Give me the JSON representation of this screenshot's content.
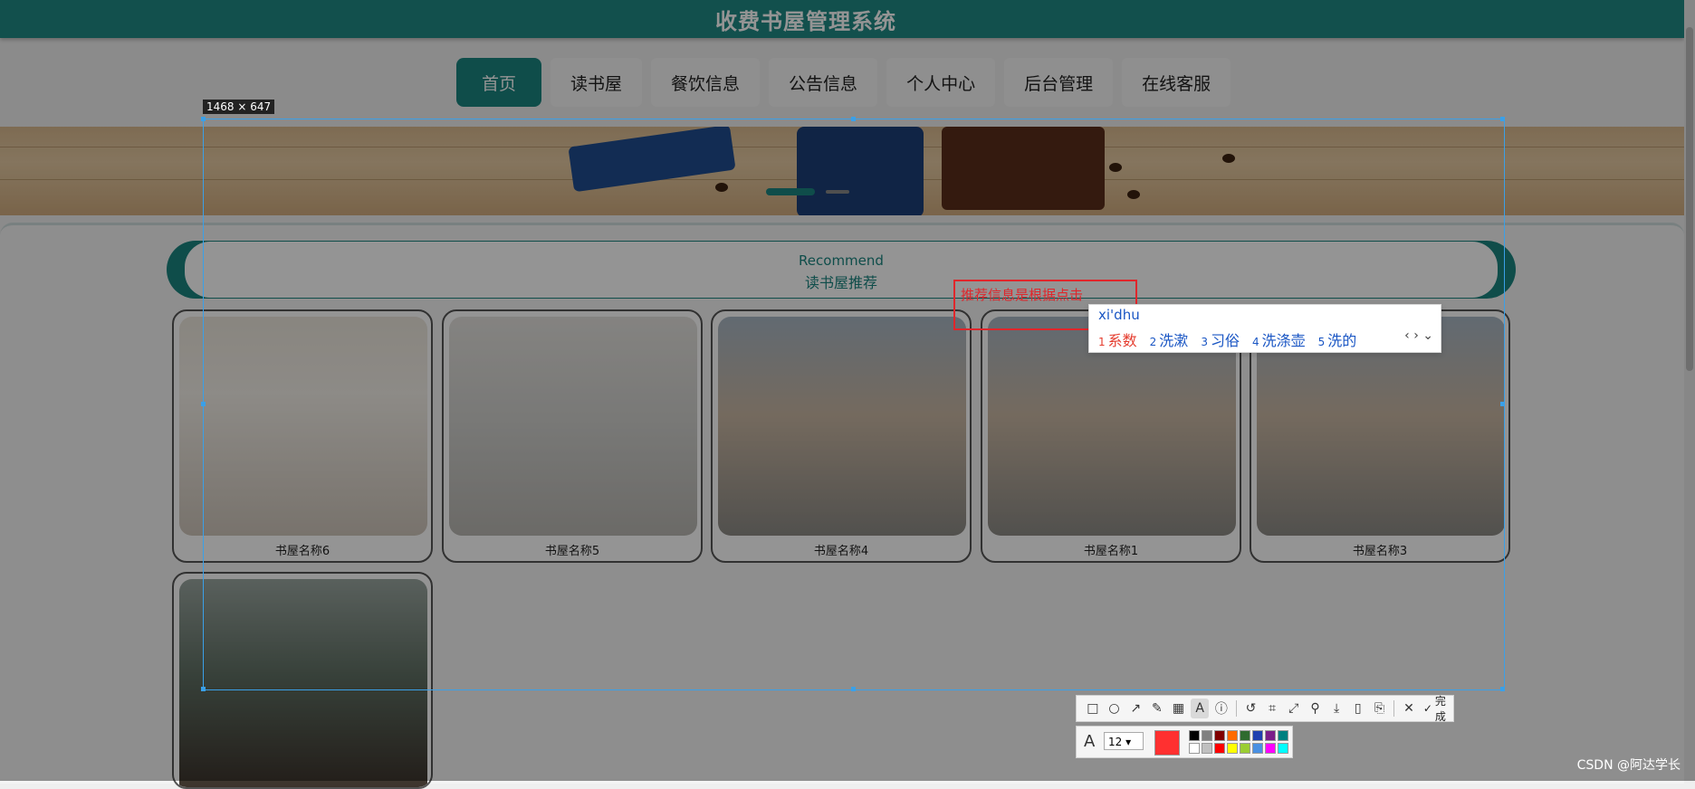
{
  "site": {
    "title": "收费书屋管理系统"
  },
  "nav": {
    "items": [
      "首页",
      "读书屋",
      "餐饮信息",
      "公告信息",
      "个人中心",
      "后台管理",
      "在线客服"
    ]
  },
  "recommend": {
    "en": "Recommend",
    "cn": "读书屋推荐"
  },
  "cards": [
    "书屋名称6",
    "书屋名称5",
    "书屋名称4",
    "书屋名称1",
    "书屋名称3"
  ],
  "screenshot_tool": {
    "size_label": "1468 × 647",
    "text_annotation": "推荐信息是根据点击",
    "ime": {
      "pinyin": "xi'dhu",
      "candidates": [
        {
          "n": "1",
          "text": "系数"
        },
        {
          "n": "2",
          "text": "洗漱"
        },
        {
          "n": "3",
          "text": "习俗"
        },
        {
          "n": "4",
          "text": "洗涤壶"
        },
        {
          "n": "5",
          "text": "洗的"
        }
      ]
    },
    "toolbar": {
      "done_label": "完成"
    },
    "font_size": "12",
    "current_color": "#ff3030"
  },
  "watermark": "CSDN @阿达学长"
}
